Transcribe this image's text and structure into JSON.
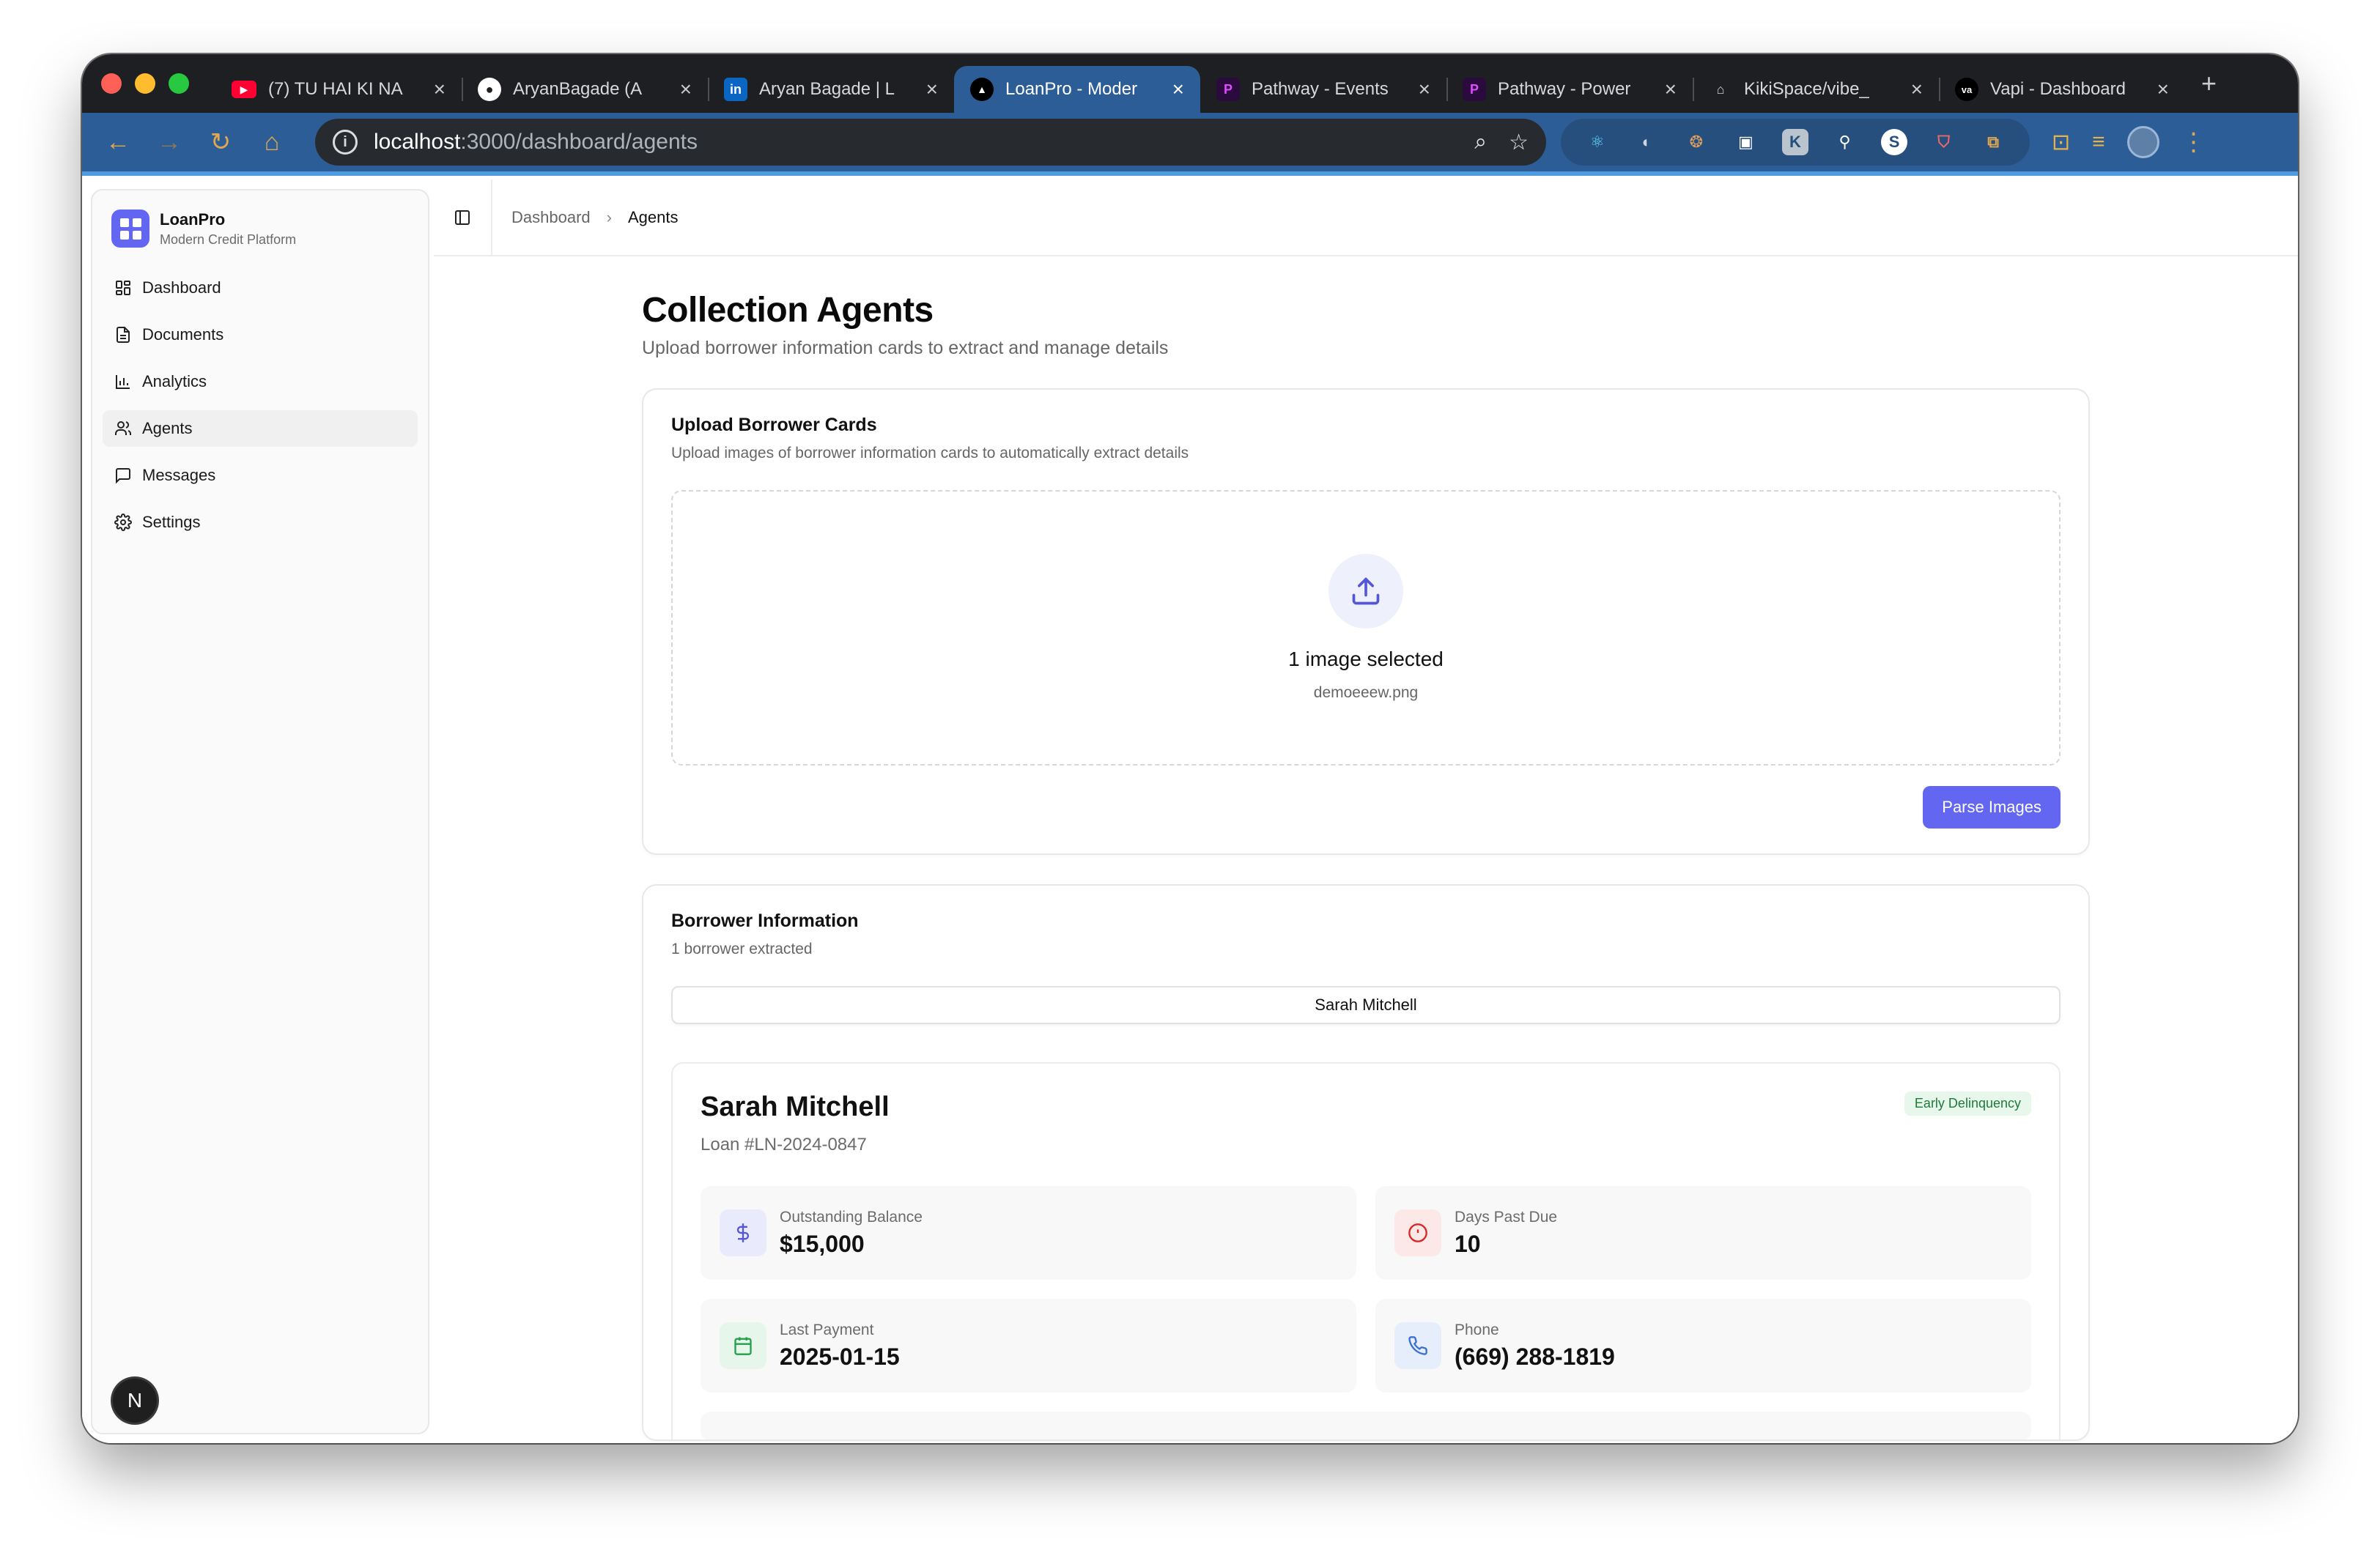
{
  "browser": {
    "tabs": [
      {
        "title": "(7) TU HAI KI NA",
        "icon": "youtube-icon"
      },
      {
        "title": "AryanBagade (A",
        "icon": "github-icon"
      },
      {
        "title": "Aryan Bagade | L",
        "icon": "linkedin-icon"
      },
      {
        "title": "LoanPro - Moder",
        "icon": "triangle-icon",
        "active": true
      },
      {
        "title": "Pathway - Events",
        "icon": "pathway-icon"
      },
      {
        "title": "Pathway - Power",
        "icon": "pathway-icon"
      },
      {
        "title": "KikiSpace/vibe_",
        "icon": "kiki-icon"
      },
      {
        "title": "Vapi - Dashboard",
        "icon": "vapi-icon"
      }
    ],
    "url_host": "localhost",
    "url_path": ":3000/dashboard/agents"
  },
  "sidebar": {
    "brand_name": "LoanPro",
    "brand_sub": "Modern Credit Platform",
    "items": [
      {
        "label": "Dashboard",
        "icon": "grid-icon"
      },
      {
        "label": "Documents",
        "icon": "document-icon"
      },
      {
        "label": "Analytics",
        "icon": "bar-chart-icon"
      },
      {
        "label": "Agents",
        "icon": "users-icon",
        "active": true
      },
      {
        "label": "Messages",
        "icon": "message-icon"
      },
      {
        "label": "Settings",
        "icon": "gear-icon"
      }
    ],
    "badge": "N"
  },
  "breadcrumb": {
    "parent": "Dashboard",
    "current": "Agents"
  },
  "page": {
    "title": "Collection Agents",
    "subtitle": "Upload borrower information cards to extract and manage details"
  },
  "upload": {
    "title": "Upload Borrower Cards",
    "subtitle": "Upload images of borrower information cards to automatically extract details",
    "selected_text": "1 image selected",
    "file_name": "demoeeew.png",
    "button": "Parse Images"
  },
  "borrower_info": {
    "title": "Borrower Information",
    "subtitle": "1 borrower extracted",
    "selected": "Sarah Mitchell"
  },
  "borrower": {
    "name": "Sarah Mitchell",
    "loan": "Loan #LN-2024-0847",
    "status": "Early Delinquency",
    "stats": {
      "balance_label": "Outstanding Balance",
      "balance_value": "$15,000",
      "dpd_label": "Days Past Due",
      "dpd_value": "10",
      "last_payment_label": "Last Payment",
      "last_payment_value": "2025-01-15",
      "phone_label": "Phone",
      "phone_value": "(669) 288-1819"
    }
  },
  "colors": {
    "accent": "#6366f1",
    "browser_blue": "#2c5d96",
    "status_green": "#1f7a3a"
  }
}
